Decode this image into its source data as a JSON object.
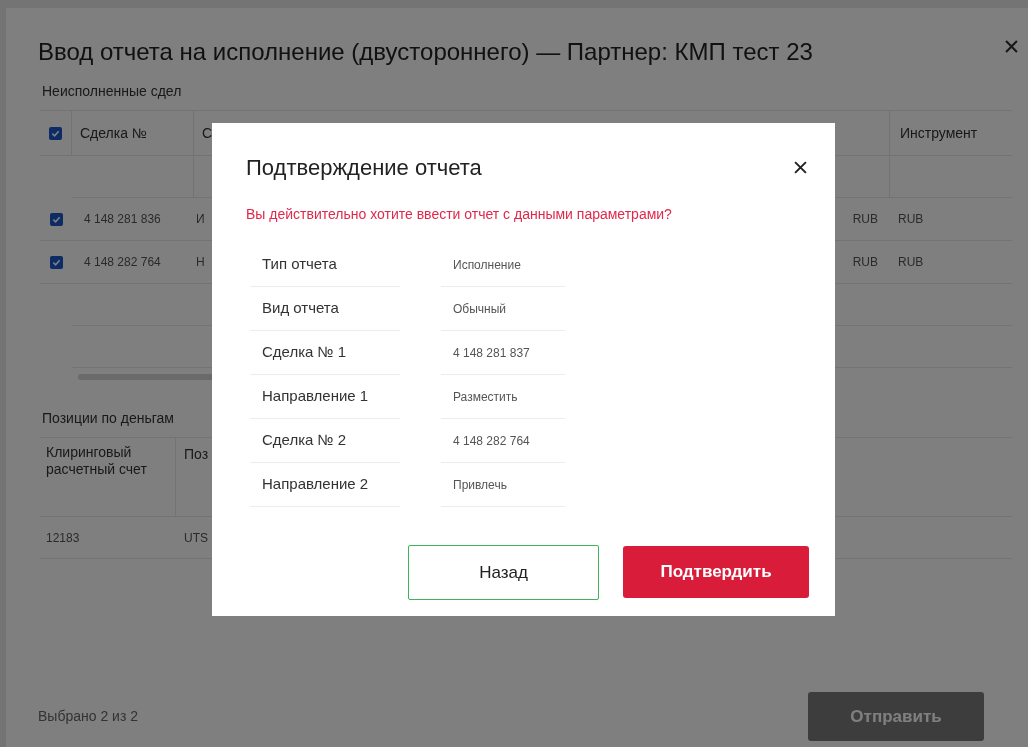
{
  "window": {
    "title": "Ввод отчета на исполнение (двустороннего) — Партнер: КМП тест 23"
  },
  "deals": {
    "label": "Неисполненные сдел",
    "header_checked": true,
    "columns": [
      "Сделка №",
      "С",
      "Инструмент"
    ],
    "rows": [
      {
        "checked": true,
        "deal": "4 148 281 836",
        "column_3": "И",
        "column_4": "RUB",
        "instrument": "RUB"
      },
      {
        "checked": true,
        "deal": "4 148 282 764",
        "column_3": "Н",
        "column_4": "RUB",
        "instrument": "RUB"
      }
    ]
  },
  "money": {
    "label": "Позиции по деньгам",
    "columns": [
      "Клиринговый расчетный счет",
      "Поз"
    ],
    "rows": [
      {
        "account": "12183",
        "column_2": "UTS"
      }
    ]
  },
  "footer": {
    "selected_text": "Выбрано 2 из 2",
    "submit": "Отправить"
  },
  "confirm": {
    "title": "Подтверждение отчета",
    "question": "Вы действительно хотите ввести отчет с данными параметрами?",
    "params": [
      {
        "label": "Тип отчета",
        "value": "Исполнение"
      },
      {
        "label": "Вид отчета",
        "value": "Обычный"
      },
      {
        "label": "Сделка № 1",
        "value": "4 148 281 837"
      },
      {
        "label": "Направление 1",
        "value": "Разместить"
      },
      {
        "label": "Сделка № 2",
        "value": "4 148 282 764"
      },
      {
        "label": "Направление 2",
        "value": "Привлечь"
      }
    ],
    "back": "Назад",
    "confirm": "Подтвердить"
  }
}
